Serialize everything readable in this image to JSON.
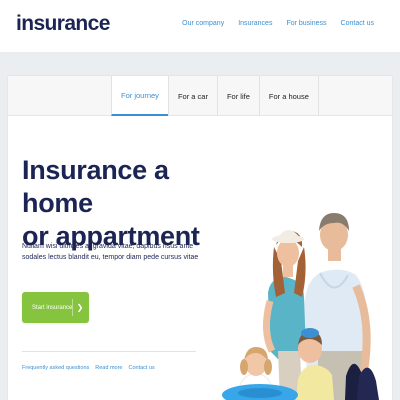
{
  "header": {
    "logo": "insurance",
    "nav": [
      "Our company",
      "Insurances",
      "For business",
      "Contact us"
    ]
  },
  "tabs": [
    {
      "label": "For journey",
      "active": true
    },
    {
      "label": "For a car",
      "active": false
    },
    {
      "label": "For life",
      "active": false
    },
    {
      "label": "For a house",
      "active": false
    }
  ],
  "hero": {
    "title_line1": "Insurance a home",
    "title_line2": "or appartment",
    "body": "Nullam wisi ultricies a, gravida vitae, dapibus risus ante sodales lectus blandit eu, tempor diam pede cursus vitae",
    "cta_label": "Start insurance"
  },
  "footer_links": [
    "Frequently asked questions",
    "Read more",
    "Contact us"
  ],
  "colors": {
    "brand_navy": "#1c2454",
    "link_blue": "#3b8fd2",
    "cta_green": "#86c440",
    "background": "#eaeef1"
  },
  "icons": {
    "cta_icon": "chevron-right-icon"
  }
}
